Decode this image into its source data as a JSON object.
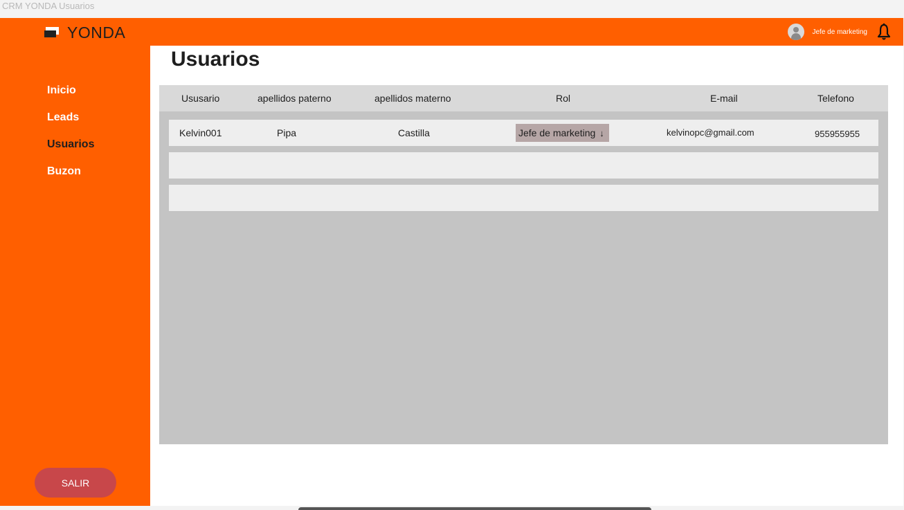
{
  "window": {
    "title": "CRM YONDA Usuarios"
  },
  "brand": {
    "name": "YONDA"
  },
  "header": {
    "user_role": "Jefe de marketing",
    "icons": {
      "avatar": "user-avatar-icon",
      "bell": "bell-icon"
    }
  },
  "sidebar": {
    "items": [
      {
        "label": "Inicio",
        "active": false
      },
      {
        "label": "Leads",
        "active": false
      },
      {
        "label": "Usuarios",
        "active": true
      },
      {
        "label": "Buzon",
        "active": false
      }
    ],
    "logout_label": "SALIR"
  },
  "main": {
    "title": "Usuarios",
    "table": {
      "columns": [
        "Ususario",
        "apellidos paterno",
        "apellidos materno",
        "Rol",
        "E-mail",
        "Telefono"
      ],
      "rows": [
        {
          "usuario": "Kelvin001",
          "apellido_paterno": "Pipa",
          "apellido_materno": "Castilla",
          "rol": "Jefe de marketing",
          "email": "kelvinopc@gmail.com",
          "telefono": "955955955"
        }
      ]
    }
  },
  "colors": {
    "primary": "#ff5f00",
    "logout": "#c8474a",
    "panel": "#c4c4c4",
    "header_row": "#d9d9d9",
    "row": "#eeeeee",
    "role_select": "#b6a6a6"
  }
}
